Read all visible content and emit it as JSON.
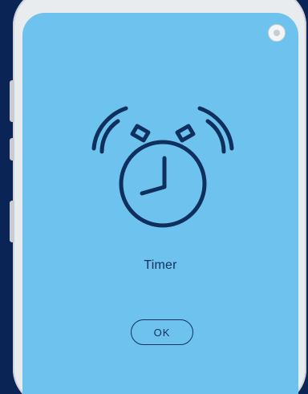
{
  "dialog": {
    "icon": "alarm-clock-icon",
    "title": "Timer",
    "ok_label": "OK"
  },
  "colors": {
    "background": "#0a2456",
    "screen": "#6ec3ee",
    "ink": "#0f2f5f",
    "phone_frame": "#e9ecef"
  }
}
